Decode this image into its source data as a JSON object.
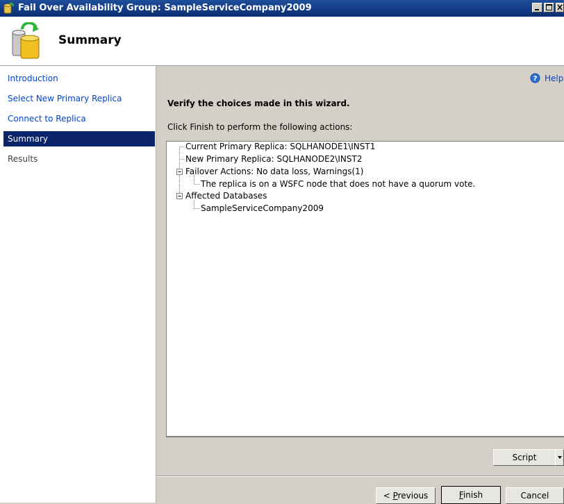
{
  "window": {
    "title": "Fail Over Availability Group: SampleServiceCompany2009"
  },
  "header": {
    "title": "Summary"
  },
  "nav": {
    "items": [
      {
        "label": "Introduction"
      },
      {
        "label": "Select New Primary Replica"
      },
      {
        "label": "Connect to Replica"
      },
      {
        "label": "Summary"
      },
      {
        "label": "Results"
      }
    ]
  },
  "help": {
    "label": "Help"
  },
  "main": {
    "heading": "Verify the choices made in this wizard.",
    "instruction": "Click Finish to perform the following actions:",
    "tree": [
      "Current Primary Replica: SQLHANODE1\\INST1",
      "New Primary Replica: SQLHANODE2\\INST2",
      "Failover Actions: No data loss, Warnings(1)",
      "The replica is on a WSFC node that does not have a quorum vote.",
      "Affected Databases",
      "SampleServiceCompany2009"
    ]
  },
  "buttons": {
    "script": "Script",
    "previous_prefix": "< ",
    "previous_mnemonic": "P",
    "previous_rest": "revious",
    "finish_mnemonic": "F",
    "finish_rest": "inish",
    "cancel": "Cancel"
  }
}
